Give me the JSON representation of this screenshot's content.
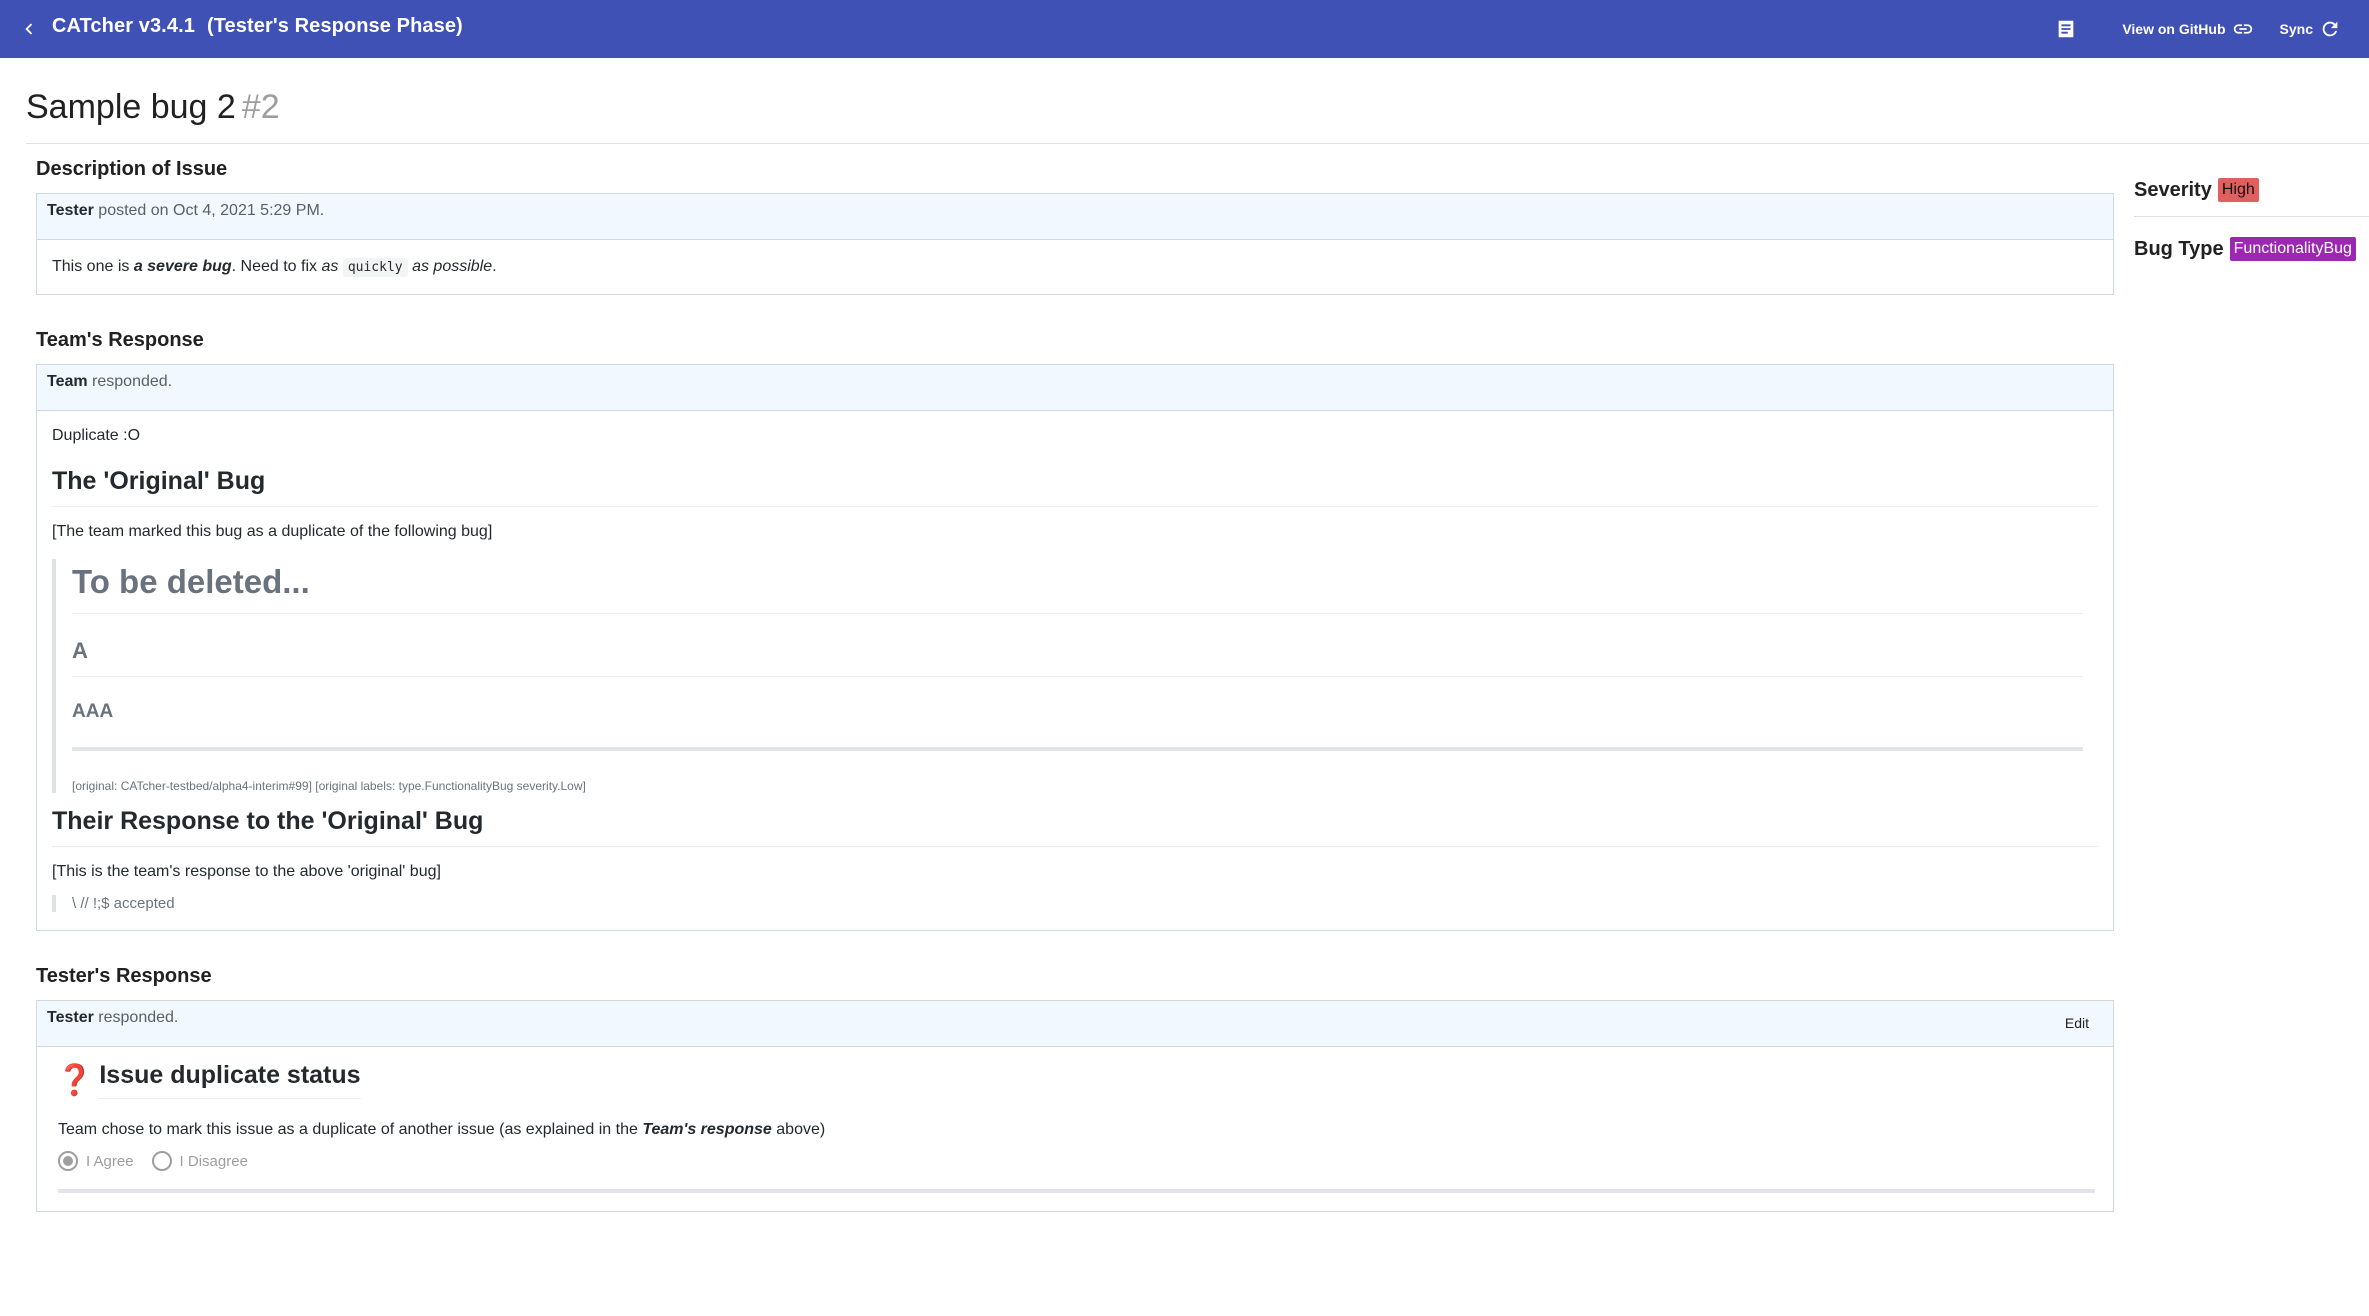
{
  "app": {
    "title": "CATcher v3.4.1",
    "phase": "(Tester's Response Phase)",
    "view_on_github": "View on GitHub",
    "sync": "Sync",
    "colors": {
      "toolbar": "#3f51b5",
      "severity_high": "#e06060",
      "functionality_bug": "#9c27b0"
    }
  },
  "issue": {
    "title": "Sample bug 2",
    "number": "#2"
  },
  "description": {
    "heading": "Description of Issue",
    "author": "Tester",
    "posted": " posted on Oct 4, 2021 5:29 PM.",
    "body_pre": "This one is ",
    "body_bold": "a severe bug",
    "body_mid": ". Need to fix ",
    "body_as1": "as",
    "body_code": "quickly",
    "body_as2": "as possible",
    "body_end": "."
  },
  "team_response": {
    "heading": "Team's Response",
    "author": "Team",
    "action": " responded.",
    "first_line": "Duplicate :O",
    "original_heading": "The 'Original' Bug",
    "original_note": "[The team marked this bug as a duplicate of the following bug]",
    "quote_h1": "To be deleted...",
    "quote_h2": "A",
    "quote_h3": "AAA",
    "original_meta": "[original: CATcher-testbed/alpha4-interim#99] [original labels: type.FunctionalityBug severity.Low]",
    "their_response_heading": "Their Response to the 'Original' Bug",
    "their_response_note": "[This is the team's response to the above 'original' bug]",
    "their_response_quote": "\\ // !;$ accepted"
  },
  "tester_response": {
    "heading": "Tester's Response",
    "author": "Tester",
    "action": " responded.",
    "edit": "Edit",
    "status_heading": "Issue duplicate status",
    "status_text_pre": "Team chose to mark this issue as a duplicate of another issue (as explained in the ",
    "status_text_bold": "Team's response",
    "status_text_post": " above)",
    "agree": "I Agree",
    "disagree": "I Disagree",
    "selected": "I Agree"
  },
  "sidebar": {
    "severity_label": "Severity",
    "severity_value": "High",
    "bug_type_label": "Bug Type",
    "bug_type_value": "FunctionalityBug"
  },
  "icons": [
    "chevron-left-icon",
    "notes-icon",
    "link-icon",
    "sync-icon",
    "question-mark-icon"
  ]
}
